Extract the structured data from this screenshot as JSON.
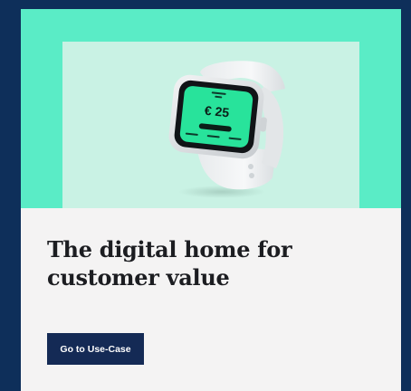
{
  "card": {
    "title": "The digital home for customer value",
    "cta_label": "Go to Use-Case"
  },
  "watch_screen": {
    "amount": "€ 25",
    "amount_unit": "",
    "icon": "smartwatch-icon"
  },
  "colors": {
    "page_background": "#0e2f5a",
    "hero_mint": "#5aecc6",
    "hero_inner": "#c9f2e4",
    "card_background": "#f4f3f3",
    "button_navy": "#142a55",
    "watch_screen_green": "#28e39b"
  }
}
